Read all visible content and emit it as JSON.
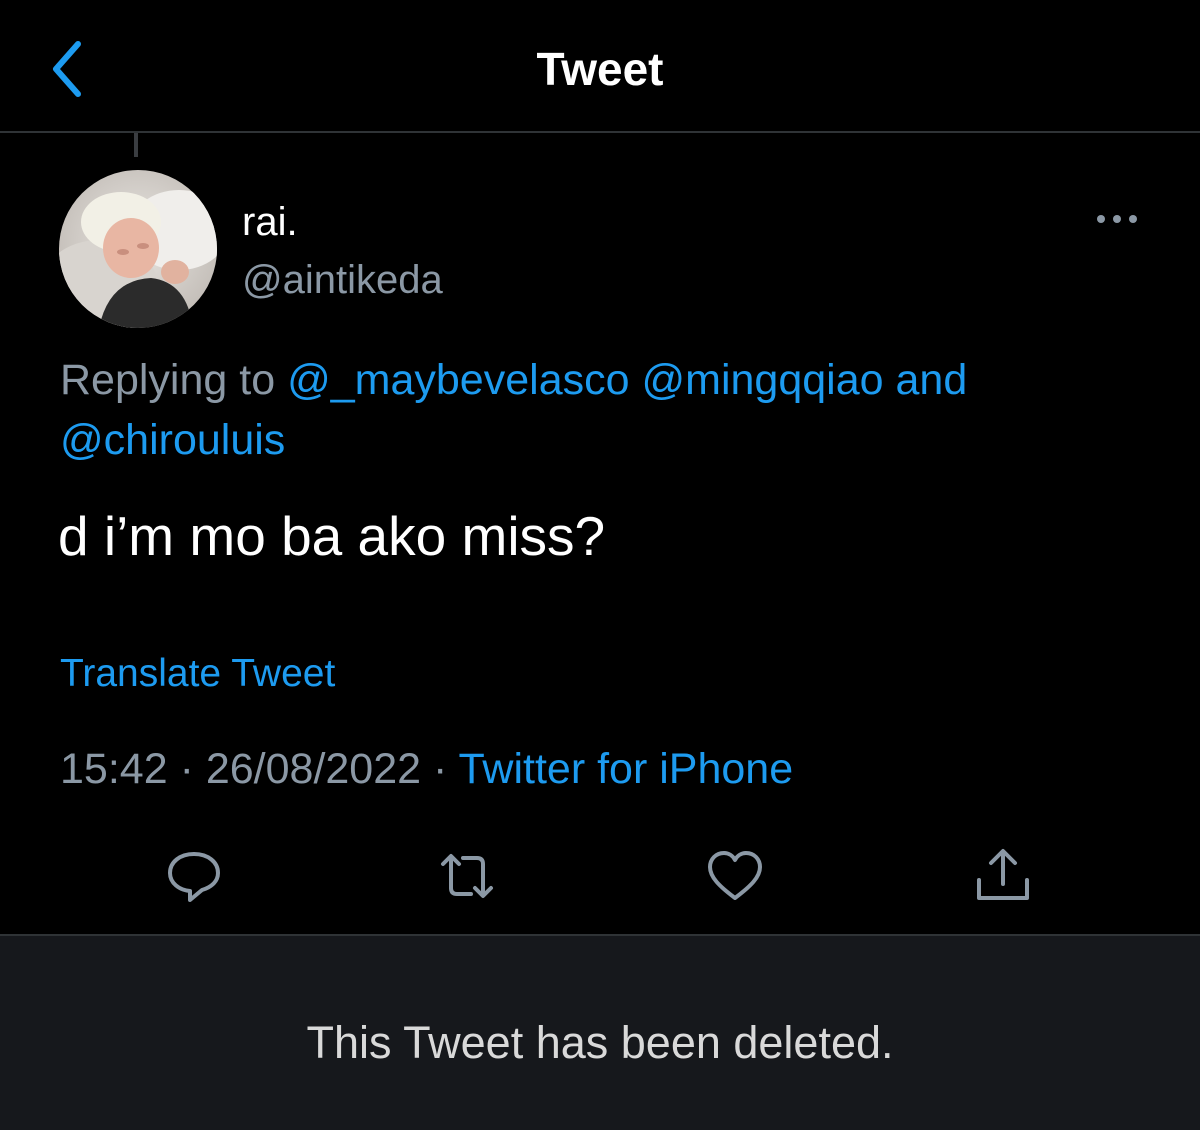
{
  "header": {
    "title": "Tweet",
    "back_icon": "chevron-left-icon"
  },
  "tweet": {
    "avatar_icon": "user-avatar",
    "display_name": "rai.",
    "handle": "@aintikeda",
    "more_icon": "more-horizontal-icon",
    "replying_prefix": "Replying to",
    "replying_mentions": [
      "@_maybevelasco",
      "@mingqqiao",
      "@chirouluis"
    ],
    "replying_joiner": "and",
    "text": "d i’m mo ba ako miss?",
    "translate_label": "Translate Tweet",
    "time": "15:42",
    "date": "26/08/2022",
    "separator": "·",
    "source": "Twitter for iPhone"
  },
  "actions": [
    {
      "name": "reply",
      "icon": "reply-icon"
    },
    {
      "name": "retweet",
      "icon": "retweet-icon"
    },
    {
      "name": "like",
      "icon": "heart-icon"
    },
    {
      "name": "share",
      "icon": "share-icon"
    }
  ],
  "deleted_notice": "This Tweet has been deleted.",
  "colors": {
    "background": "#000000",
    "accent": "#1d9bf0",
    "muted": "#8b98a5",
    "panel": "#16181c",
    "divider": "#2f3336"
  }
}
